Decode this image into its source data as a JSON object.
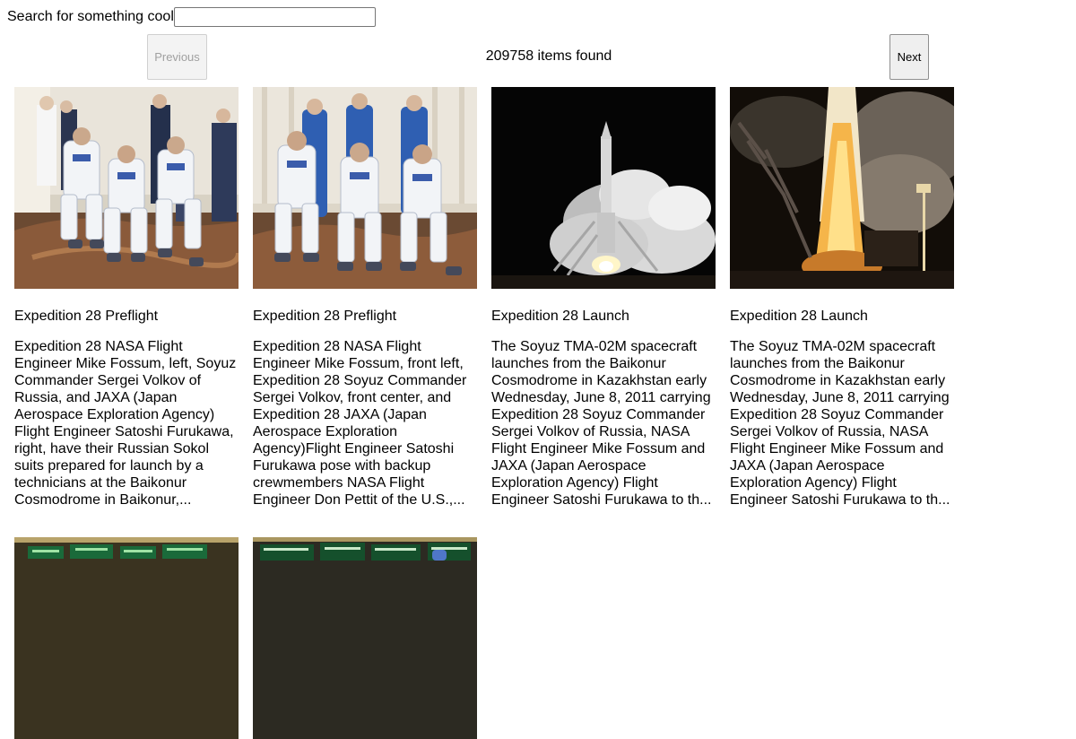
{
  "search": {
    "label": "Search for something cool",
    "value": "",
    "placeholder": ""
  },
  "pager": {
    "previous_label": "Previous",
    "next_label": "Next",
    "count_text": "209758 items found"
  },
  "results": [
    {
      "title": "Expedition 28 Preflight",
      "description": "Expedition 28 NASA Flight Engineer Mike Fossum, left, Soyuz Commander Sergei Volkov of Russia, and JAXA (Japan Aerospace Exploration Agency) Flight Engineer Satoshi Furukawa, right, have their Russian Sokol suits prepared for launch by a technicians at the Baikonur Cosmodrome in Baikonur,...",
      "image": "crew-in-suits-seated-photo"
    },
    {
      "title": "Expedition 28 Preflight",
      "description": "Expedition 28 NASA Flight Engineer Mike Fossum, front left, Expedition 28 Soyuz Commander Sergei Volkov, front center, and Expedition 28 JAXA (Japan Aerospace Exploration Agency)Flight Engineer Satoshi Furukawa pose with backup crewmembers NASA Flight Engineer Don Pettit of the U.S.,...",
      "image": "crew-with-backup-photo"
    },
    {
      "title": "Expedition 28 Launch",
      "description": "The Soyuz TMA-02M spacecraft launches from the Baikonur Cosmodrome in Kazakhstan early Wednesday, June 8, 2011 carrying Expedition 28 Soyuz Commander Sergei Volkov of Russia, NASA Flight Engineer Mike Fossum and JAXA (Japan Aerospace Exploration Agency) Flight Engineer Satoshi Furukawa to th...",
      "image": "rocket-launch-night-photo"
    },
    {
      "title": "Expedition 28 Launch",
      "description": "The Soyuz TMA-02M spacecraft launches from the Baikonur Cosmodrome in Kazakhstan early Wednesday, June 8, 2011 carrying Expedition 28 Soyuz Commander Sergei Volkov of Russia, NASA Flight Engineer Mike Fossum and JAXA (Japan Aerospace Exploration Agency) Flight Engineer Satoshi Furukawa to th...",
      "image": "rocket-launch-flame-photo"
    },
    {
      "title": "",
      "description": "",
      "image": "control-room-photo"
    },
    {
      "title": "",
      "description": "",
      "image": "control-room-screens-photo"
    }
  ]
}
